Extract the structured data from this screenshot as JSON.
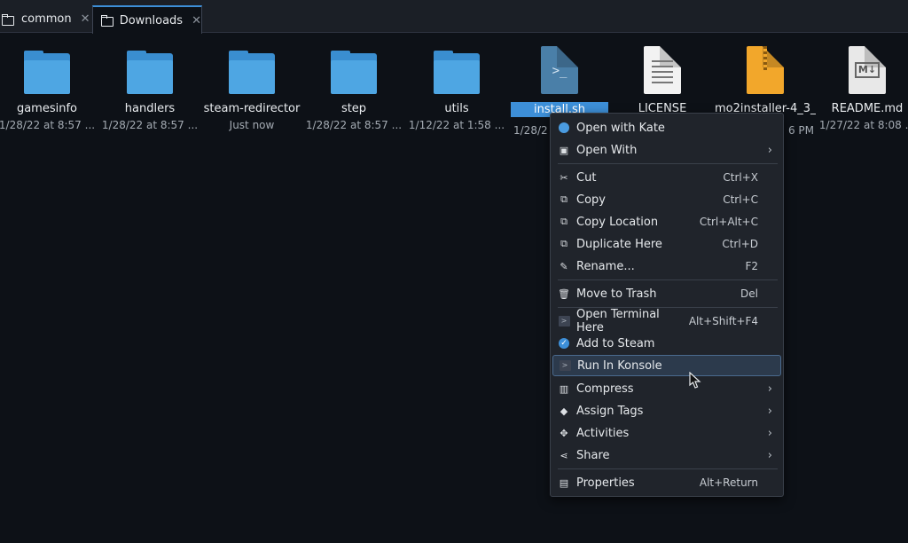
{
  "tabs": [
    {
      "label": "common",
      "active": false
    },
    {
      "label": "Downloads",
      "active": true
    }
  ],
  "files": [
    {
      "name": "gamesinfo",
      "date": "1/28/22 at 8:57 ...",
      "type": "folder"
    },
    {
      "name": "handlers",
      "date": "1/28/22 at 8:57 ...",
      "type": "folder"
    },
    {
      "name": "steam-redirector",
      "date": "Just now",
      "type": "folder"
    },
    {
      "name": "step",
      "date": "1/28/22 at 8:57 ...",
      "type": "folder"
    },
    {
      "name": "utils",
      "date": "1/12/22 at 1:58 ...",
      "type": "folder"
    },
    {
      "name": "install.sh",
      "date": "1/28/2",
      "type": "script",
      "selected": true
    },
    {
      "name": "LICENSE",
      "date": "",
      "type": "text"
    },
    {
      "name": "mo2installer-4_3_",
      "date": "6 PM",
      "type": "archive"
    },
    {
      "name": "README.md",
      "date": "1/27/22 at 8:08 ...",
      "type": "markdown"
    }
  ],
  "context_menu": {
    "items": [
      {
        "label": "Open with Kate",
        "icon": "kate-icon",
        "shortcut": "",
        "submenu": false
      },
      {
        "label": "Open With",
        "icon": "open-with-icon",
        "shortcut": "",
        "submenu": true
      },
      {
        "label": "Cut",
        "icon": "scissors-icon",
        "shortcut": "Ctrl+X",
        "submenu": false
      },
      {
        "label": "Copy",
        "icon": "copy-icon",
        "shortcut": "Ctrl+C",
        "submenu": false
      },
      {
        "label": "Copy Location",
        "icon": "copy-location-icon",
        "shortcut": "Ctrl+Alt+C",
        "submenu": false
      },
      {
        "label": "Duplicate Here",
        "icon": "duplicate-icon",
        "shortcut": "Ctrl+D",
        "submenu": false
      },
      {
        "label": "Rename...",
        "icon": "pencil-icon",
        "shortcut": "F2",
        "submenu": false
      },
      {
        "label": "Move to Trash",
        "icon": "trash-icon",
        "shortcut": "Del",
        "submenu": false
      },
      {
        "label": "Open Terminal Here",
        "icon": "terminal-icon",
        "shortcut": "Alt+Shift+F4",
        "submenu": false
      },
      {
        "label": "Add to Steam",
        "icon": "steam-check-icon",
        "shortcut": "",
        "submenu": false
      },
      {
        "label": "Run In Konsole",
        "icon": "konsole-icon",
        "shortcut": "",
        "submenu": false,
        "hovered": true
      },
      {
        "label": "Compress",
        "icon": "compress-icon",
        "shortcut": "",
        "submenu": true
      },
      {
        "label": "Assign Tags",
        "icon": "tag-icon",
        "shortcut": "",
        "submenu": true
      },
      {
        "label": "Activities",
        "icon": "activities-icon",
        "shortcut": "",
        "submenu": true
      },
      {
        "label": "Share",
        "icon": "share-icon",
        "shortcut": "",
        "submenu": true
      },
      {
        "label": "Properties",
        "icon": "properties-icon",
        "shortcut": "Alt+Return",
        "submenu": false
      }
    ]
  }
}
